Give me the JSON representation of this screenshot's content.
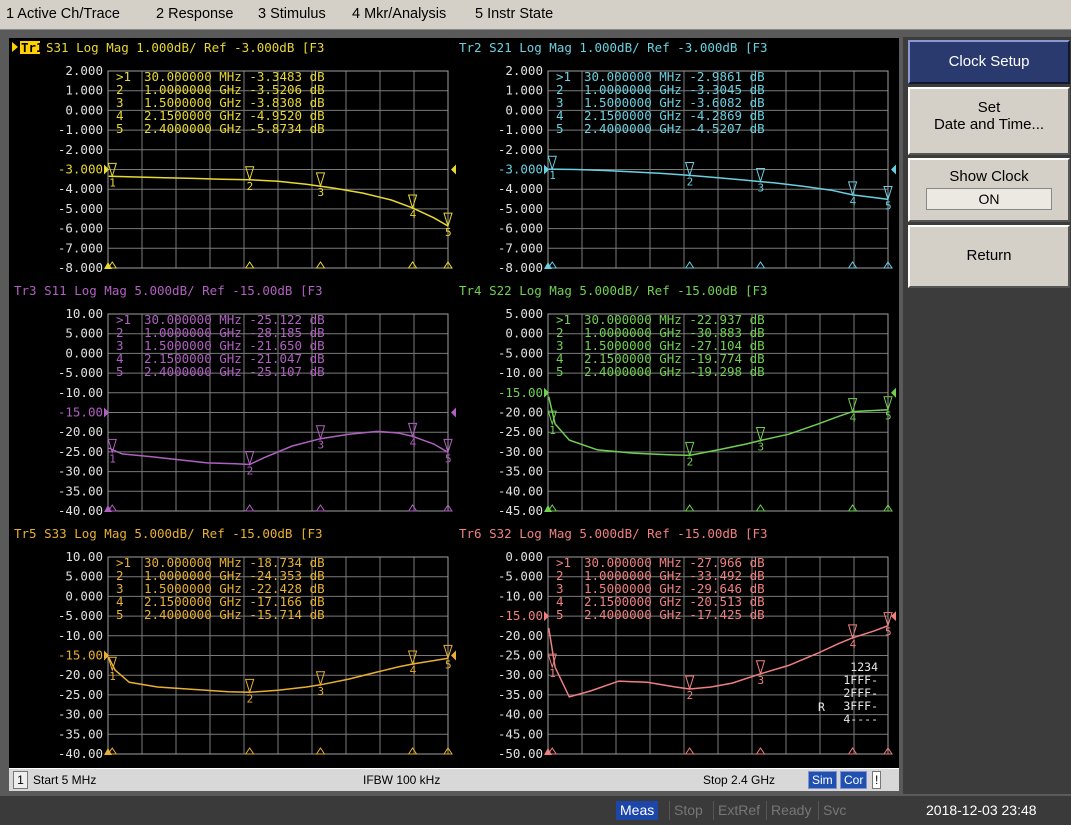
{
  "menu": [
    "1 Active Ch/Trace",
    "2 Response",
    "3 Stimulus",
    "4 Mkr/Analysis",
    "5 Instr State"
  ],
  "softkeys": {
    "clock_setup": "Clock Setup",
    "set_line1": "Set",
    "set_line2": "Date and Time...",
    "show_clock": "Show Clock",
    "show_clock_value": "ON",
    "return": "Return"
  },
  "status": {
    "channel": "1",
    "start": "Start 5 MHz",
    "ifbw": "IFBW 100 kHz",
    "stop": "Stop 2.4 GHz",
    "sim": "Sim",
    "cor": "Cor",
    "excl": "!"
  },
  "bottom": {
    "meas": "Meas",
    "stop": "Stop",
    "extref": "ExtRef",
    "ready": "Ready",
    "svc": "Svc",
    "clock": "2018-12-03 23:48"
  },
  "colors": {
    "tr1": "#e8d832",
    "tr2": "#6ad0e0",
    "tr3": "#b060c0",
    "tr4": "#70d050",
    "tr5": "#e8b030",
    "tr6": "#f08080",
    "grid": "#7a7a7a",
    "active_tag": "#ffd000"
  },
  "marker_table_overlay": [
    "1234",
    "1FFF-",
    "2FFF-",
    "3FFF-",
    "4----"
  ],
  "marker_table_prefix": "R",
  "traces": [
    {
      "id": "Tr1",
      "title": "S31 Log Mag 1.000dB/ Ref -3.000dB [F3",
      "color": "#e8d832",
      "active": true,
      "ylabels": [
        "2.000",
        "1.000",
        "0.000",
        "-1.000",
        "-2.000",
        "-3.000",
        "-4.000",
        "-5.000",
        "-6.000",
        "-7.000",
        "-8.000"
      ],
      "ref_index": 5,
      "ymin": -8,
      "ymax": 2,
      "markers": [
        {
          "num": "1",
          "text": "30.000000 MHz -3.3483 dB",
          "x": 0.03,
          "value": -3.3483
        },
        {
          "num": "2",
          "text": "1.0000000 GHz -3.5206 dB",
          "x": 1.0,
          "value": -3.5206
        },
        {
          "num": "3",
          "text": "1.5000000 GHz -3.8308 dB",
          "x": 1.5,
          "value": -3.8308
        },
        {
          "num": "4",
          "text": "2.1500000 GHz -4.9520 dB",
          "x": 2.15,
          "value": -4.952
        },
        {
          "num": "5",
          "text": "2.4000000 GHz -5.8734 dB",
          "x": 2.4,
          "value": -5.8734
        }
      ],
      "trace": [
        [
          0.005,
          -3.34
        ],
        [
          0.2,
          -3.38
        ],
        [
          0.4,
          -3.42
        ],
        [
          0.6,
          -3.45
        ],
        [
          0.8,
          -3.49
        ],
        [
          1.0,
          -3.52
        ],
        [
          1.2,
          -3.6
        ],
        [
          1.4,
          -3.75
        ],
        [
          1.6,
          -3.95
        ],
        [
          1.8,
          -4.2
        ],
        [
          2.0,
          -4.55
        ],
        [
          2.15,
          -4.95
        ],
        [
          2.3,
          -5.45
        ],
        [
          2.4,
          -5.87
        ]
      ]
    },
    {
      "id": "Tr2",
      "title": "S21 Log Mag 1.000dB/ Ref -3.000dB [F3",
      "color": "#6ad0e0",
      "active": false,
      "ylabels": [
        "2.000",
        "1.000",
        "0.000",
        "-1.000",
        "-2.000",
        "-3.000",
        "-4.000",
        "-5.000",
        "-6.000",
        "-7.000",
        "-8.000"
      ],
      "ref_index": 5,
      "ymin": -8,
      "ymax": 2,
      "markers": [
        {
          "num": "1",
          "text": "30.000000 MHz -2.9861 dB",
          "x": 0.03,
          "value": -2.9861
        },
        {
          "num": "2",
          "text": "1.0000000 GHz -3.3045 dB",
          "x": 1.0,
          "value": -3.3045
        },
        {
          "num": "3",
          "text": "1.5000000 GHz -3.6082 dB",
          "x": 1.5,
          "value": -3.6082
        },
        {
          "num": "4",
          "text": "2.1500000 GHz -4.2869 dB",
          "x": 2.15,
          "value": -4.2869
        },
        {
          "num": "5",
          "text": "2.4000000 GHz -4.5207 dB",
          "x": 2.4,
          "value": -4.5207
        }
      ],
      "trace": [
        [
          0.005,
          -2.98
        ],
        [
          0.2,
          -3.0
        ],
        [
          0.4,
          -3.05
        ],
        [
          0.6,
          -3.12
        ],
        [
          0.8,
          -3.2
        ],
        [
          1.0,
          -3.3
        ],
        [
          1.2,
          -3.42
        ],
        [
          1.4,
          -3.55
        ],
        [
          1.6,
          -3.68
        ],
        [
          1.8,
          -3.85
        ],
        [
          2.0,
          -4.05
        ],
        [
          2.15,
          -4.29
        ],
        [
          2.3,
          -4.42
        ],
        [
          2.4,
          -4.52
        ]
      ]
    },
    {
      "id": "Tr3",
      "title": "S11 Log Mag 5.000dB/ Ref -15.00dB [F3",
      "color": "#b060c0",
      "active": false,
      "ylabels": [
        "10.00",
        "5.000",
        "0.000",
        "-5.000",
        "-10.00",
        "-15.00",
        "-20.00",
        "-25.00",
        "-30.00",
        "-35.00",
        "-40.00"
      ],
      "ref_index": 5,
      "ymin": -40,
      "ymax": 10,
      "markers": [
        {
          "num": "1",
          "text": "30.000000 MHz -25.122 dB",
          "x": 0.03,
          "value": -25.122
        },
        {
          "num": "2",
          "text": "1.0000000 GHz -28.185 dB",
          "x": 1.0,
          "value": -28.185
        },
        {
          "num": "3",
          "text": "1.5000000 GHz -21.650 dB",
          "x": 1.5,
          "value": -21.65
        },
        {
          "num": "4",
          "text": "2.1500000 GHz -21.047 dB",
          "x": 2.15,
          "value": -21.047
        },
        {
          "num": "5",
          "text": "2.4000000 GHz -25.107 dB",
          "x": 2.4,
          "value": -25.107
        }
      ],
      "trace": [
        [
          0.005,
          -24.0
        ],
        [
          0.1,
          -25.5
        ],
        [
          0.3,
          -26.2
        ],
        [
          0.5,
          -27.0
        ],
        [
          0.7,
          -27.8
        ],
        [
          0.9,
          -28.0
        ],
        [
          1.0,
          -28.2
        ],
        [
          1.1,
          -26.5
        ],
        [
          1.3,
          -23.5
        ],
        [
          1.5,
          -21.65
        ],
        [
          1.7,
          -20.5
        ],
        [
          1.9,
          -19.8
        ],
        [
          2.05,
          -20.2
        ],
        [
          2.15,
          -21.05
        ],
        [
          2.3,
          -23.0
        ],
        [
          2.4,
          -25.1
        ]
      ]
    },
    {
      "id": "Tr4",
      "title": "S22 Log Mag 5.000dB/ Ref -15.00dB [F3",
      "color": "#70d050",
      "active": false,
      "ylabels": [
        "5.000",
        "0.000",
        "-5.000",
        "-10.00",
        "-15.00",
        "-20.00",
        "-25.00",
        "-30.00",
        "-35.00",
        "-40.00",
        "-45.00"
      ],
      "ref_index": 4,
      "ymin": -45,
      "ymax": 5,
      "markers": [
        {
          "num": "1",
          "text": "30.000000 MHz -22.937 dB",
          "x": 0.03,
          "value": -22.937
        },
        {
          "num": "2",
          "text": "1.0000000 GHz -30.883 dB",
          "x": 1.0,
          "value": -30.883
        },
        {
          "num": "3",
          "text": "1.5000000 GHz -27.104 dB",
          "x": 1.5,
          "value": -27.104
        },
        {
          "num": "4",
          "text": "2.1500000 GHz -19.774 dB",
          "x": 2.15,
          "value": -19.774
        },
        {
          "num": "5",
          "text": "2.4000000 GHz -19.298 dB",
          "x": 2.4,
          "value": -19.298
        }
      ],
      "trace": [
        [
          0.005,
          -16.0
        ],
        [
          0.05,
          -22.9
        ],
        [
          0.15,
          -27.0
        ],
        [
          0.35,
          -29.5
        ],
        [
          0.6,
          -30.3
        ],
        [
          0.85,
          -30.7
        ],
        [
          1.0,
          -30.88
        ],
        [
          1.2,
          -29.5
        ],
        [
          1.4,
          -28.0
        ],
        [
          1.5,
          -27.1
        ],
        [
          1.7,
          -25.5
        ],
        [
          1.9,
          -23.0
        ],
        [
          2.05,
          -21.0
        ],
        [
          2.15,
          -19.77
        ],
        [
          2.3,
          -19.5
        ],
        [
          2.4,
          -19.3
        ]
      ]
    },
    {
      "id": "Tr5",
      "title": "S33 Log Mag 5.000dB/ Ref -15.00dB [F3",
      "color": "#e8b030",
      "active": false,
      "ylabels": [
        "10.00",
        "5.000",
        "0.000",
        "-5.000",
        "-10.00",
        "-15.00",
        "-20.00",
        "-25.00",
        "-30.00",
        "-35.00",
        "-40.00"
      ],
      "ref_index": 5,
      "ymin": -40,
      "ymax": 10,
      "markers": [
        {
          "num": "1",
          "text": "30.000000 MHz -18.734 dB",
          "x": 0.03,
          "value": -18.734
        },
        {
          "num": "2",
          "text": "1.0000000 GHz -24.353 dB",
          "x": 1.0,
          "value": -24.353
        },
        {
          "num": "3",
          "text": "1.5000000 GHz -22.428 dB",
          "x": 1.5,
          "value": -22.428
        },
        {
          "num": "4",
          "text": "2.1500000 GHz -17.166 dB",
          "x": 2.15,
          "value": -17.166
        },
        {
          "num": "5",
          "text": "2.4000000 GHz -15.714 dB",
          "x": 2.4,
          "value": -15.714
        }
      ],
      "trace": [
        [
          0.005,
          -15.5
        ],
        [
          0.05,
          -18.7
        ],
        [
          0.15,
          -21.8
        ],
        [
          0.35,
          -23.0
        ],
        [
          0.6,
          -23.6
        ],
        [
          0.85,
          -24.2
        ],
        [
          1.0,
          -24.35
        ],
        [
          1.2,
          -23.8
        ],
        [
          1.4,
          -23.0
        ],
        [
          1.5,
          -22.43
        ],
        [
          1.7,
          -21.0
        ],
        [
          1.9,
          -19.2
        ],
        [
          2.05,
          -17.9
        ],
        [
          2.15,
          -17.17
        ],
        [
          2.3,
          -16.3
        ],
        [
          2.4,
          -15.7
        ]
      ]
    },
    {
      "id": "Tr6",
      "title": "S32 Log Mag 5.000dB/ Ref -15.00dB [F3",
      "color": "#f08080",
      "active": false,
      "ylabels": [
        "0.000",
        "-5.000",
        "-10.00",
        "-15.00",
        "-20.00",
        "-25.00",
        "-30.00",
        "-35.00",
        "-40.00",
        "-45.00",
        "-50.00"
      ],
      "ref_index": 3,
      "ymin": -50,
      "ymax": 0,
      "markers": [
        {
          "num": "1",
          "text": "30.000000 MHz -27.966 dB",
          "x": 0.03,
          "value": -27.966
        },
        {
          "num": "2",
          "text": "1.0000000 GHz -33.492 dB",
          "x": 1.0,
          "value": -33.492
        },
        {
          "num": "3",
          "text": "1.5000000 GHz -29.646 dB",
          "x": 1.5,
          "value": -29.646
        },
        {
          "num": "4",
          "text": "2.1500000 GHz -20.513 dB",
          "x": 2.15,
          "value": -20.513
        },
        {
          "num": "5",
          "text": "2.4000000 GHz -17.425 dB",
          "x": 2.4,
          "value": -17.425
        }
      ],
      "trace": [
        [
          0.005,
          -18.0
        ],
        [
          0.05,
          -28.0
        ],
        [
          0.15,
          -35.5
        ],
        [
          0.3,
          -34.0
        ],
        [
          0.5,
          -31.5
        ],
        [
          0.7,
          -31.8
        ],
        [
          0.9,
          -33.0
        ],
        [
          1.0,
          -33.49
        ],
        [
          1.15,
          -33.0
        ],
        [
          1.3,
          -32.0
        ],
        [
          1.5,
          -29.65
        ],
        [
          1.7,
          -27.5
        ],
        [
          1.9,
          -24.5
        ],
        [
          2.05,
          -22.0
        ],
        [
          2.15,
          -20.51
        ],
        [
          2.3,
          -18.8
        ],
        [
          2.4,
          -17.43
        ]
      ]
    }
  ]
}
